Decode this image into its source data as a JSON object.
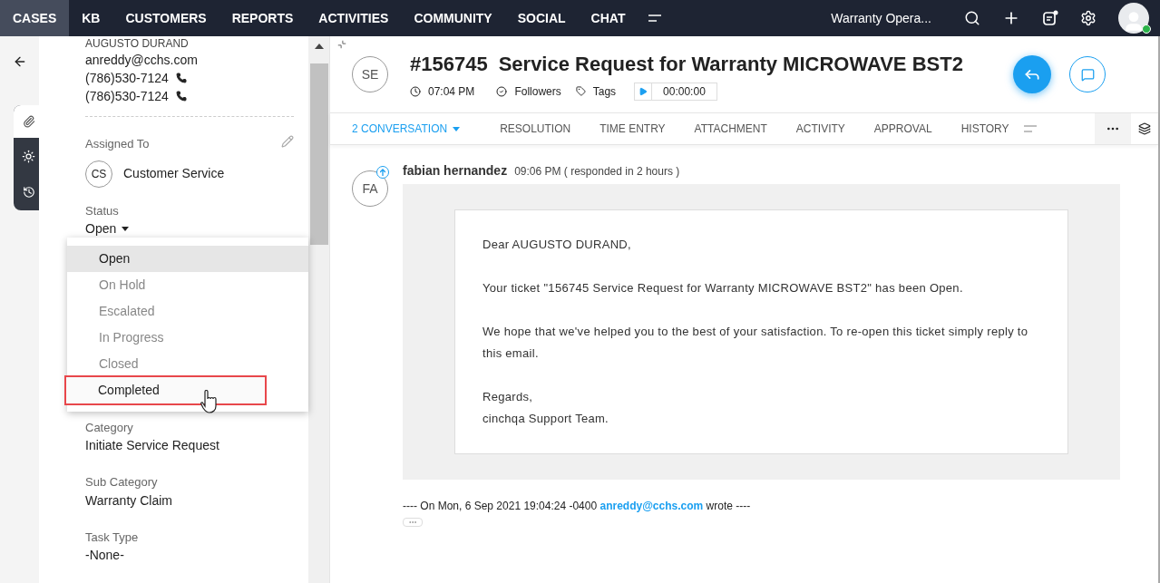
{
  "nav": {
    "items": [
      {
        "label": "CASES",
        "selected": true
      },
      {
        "label": "KB",
        "selected": false
      },
      {
        "label": "CUSTOMERS",
        "selected": false
      },
      {
        "label": "REPORTS",
        "selected": false
      },
      {
        "label": "ACTIVITIES",
        "selected": false
      },
      {
        "label": "COMMUNITY",
        "selected": false
      },
      {
        "label": "SOCIAL",
        "selected": false
      },
      {
        "label": "CHAT",
        "selected": false
      }
    ],
    "department": "Warranty Opera..."
  },
  "contact": {
    "name": "AUGUSTO DURAND",
    "email": "anreddy@cchs.com",
    "phones": [
      "(786)530-7124",
      "(786)530-7124"
    ]
  },
  "assigned": {
    "label": "Assigned To",
    "initials": "CS",
    "name": "Customer Service"
  },
  "status": {
    "label": "Status",
    "value": "Open",
    "options": [
      {
        "label": "Open",
        "selected": true,
        "highlighted": false
      },
      {
        "label": "On Hold",
        "selected": false,
        "highlighted": false
      },
      {
        "label": "Escalated",
        "selected": false,
        "highlighted": false
      },
      {
        "label": "In Progress",
        "selected": false,
        "highlighted": false
      },
      {
        "label": "Closed",
        "selected": false,
        "highlighted": false
      },
      {
        "label": "Completed",
        "selected": false,
        "highlighted": true
      }
    ]
  },
  "fields": [
    {
      "label": "Category",
      "value": "Initiate Service Request"
    },
    {
      "label": "Sub Category",
      "value": "Warranty Claim"
    },
    {
      "label": "Task Type",
      "value": "-None-"
    }
  ],
  "ticket": {
    "initials": "SE",
    "number": "#156745",
    "title": "Service Request for Warranty MICROWAVE BST2",
    "time": "07:04 PM",
    "followers": "Followers",
    "tags": "Tags",
    "timer": "00:00:00"
  },
  "tabs": [
    {
      "label": "2 CONVERSATION",
      "selected": true
    },
    {
      "label": "RESOLUTION",
      "selected": false
    },
    {
      "label": "TIME ENTRY",
      "selected": false
    },
    {
      "label": "ATTACHMENT",
      "selected": false
    },
    {
      "label": "ACTIVITY",
      "selected": false
    },
    {
      "label": "APPROVAL",
      "selected": false
    },
    {
      "label": "HISTORY",
      "selected": false
    }
  ],
  "message": {
    "initials": "FA",
    "author": "fabian hernandez",
    "time": "09:06 PM",
    "note": "( responded in 2 hours )",
    "body": [
      "Dear AUGUSTO DURAND,",
      "Your ticket \"156745 Service Request for Warranty MICROWAVE BST2\" has been Open.",
      "We hope that we've helped you to the best of your satisfaction. To re-open this ticket simply reply to this email."
    ],
    "signoff": [
      "Regards,",
      "cinchqa Support Team."
    ],
    "quote_prefix": "---- On  Mon, 6 Sep 2021 19:04:24 -0400",
    "quote_email": "anreddy@cchs.com",
    "quote_suffix": "wrote ----"
  }
}
